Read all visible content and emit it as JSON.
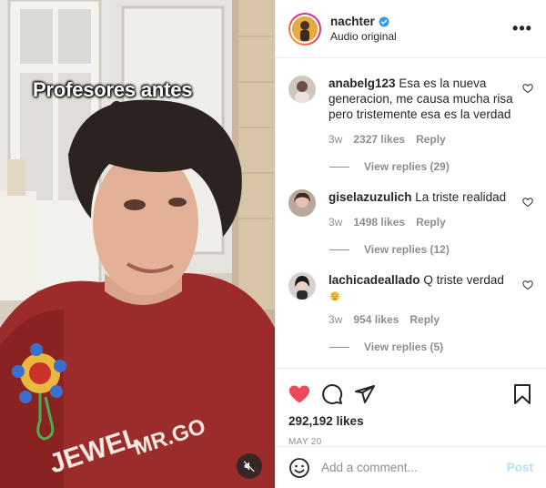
{
  "media": {
    "overlay_text": "Profesores antes",
    "mute_icon": "speaker-muted-icon"
  },
  "header": {
    "username": "nachter",
    "subtitle": "Audio original",
    "verified_icon": "verified-badge-icon",
    "more_icon": "more-options-icon",
    "more_glyph": "•••",
    "verified_color": "#3897f0"
  },
  "comments": [
    {
      "username": "anabelg123",
      "text": "Esa es la nueva generacion, me causa mucha risa pero tristemente esa es la verdad",
      "age": "3w",
      "likes": "2327 likes",
      "reply_label": "Reply",
      "view_replies": "View replies (29)"
    },
    {
      "username": "giselazuzulich",
      "text": "La triste realidad",
      "age": "3w",
      "likes": "1498 likes",
      "reply_label": "Reply",
      "view_replies": "View replies (12)"
    },
    {
      "username": "lachicadeallado",
      "text": "Q triste verdad",
      "age": "3w",
      "likes": "954 likes",
      "reply_label": "Reply",
      "view_replies": "View replies (5)"
    }
  ],
  "actions": {
    "like_icon": "heart-filled-icon",
    "comment_icon": "comment-bubble-icon",
    "share_icon": "paper-plane-icon",
    "save_icon": "bookmark-icon",
    "like_color": "#ed4956",
    "like_count": "292,192 likes",
    "date": "MAY 20"
  },
  "add_comment": {
    "placeholder": "Add a comment...",
    "post_label": "Post",
    "emoji_icon": "smiley-icon",
    "post_color": "#b2dffc"
  }
}
